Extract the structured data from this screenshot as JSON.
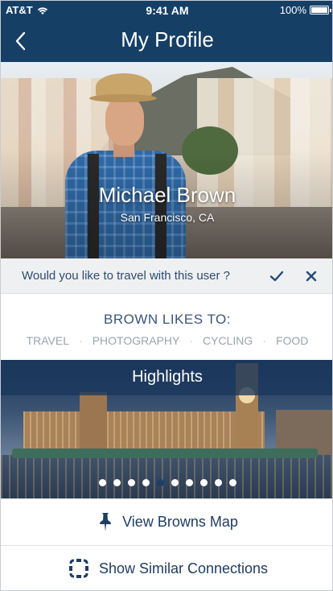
{
  "status_bar": {
    "carrier": "AT&T",
    "time": "9:41 AM",
    "battery": "100%"
  },
  "nav": {
    "title": "My Profile",
    "back_icon": "chevron-left-icon"
  },
  "profile": {
    "name": "Michael Brown",
    "location": "San Francisco, CA"
  },
  "travel_prompt": {
    "question": "Would you like to travel with this user ?",
    "accept_icon": "check-icon",
    "decline_icon": "close-icon"
  },
  "likes": {
    "title": "BROWN LIKES TO:",
    "tags": [
      "TRAVEL",
      "PHOTOGRAPHY",
      "CYCLING",
      "FOOD"
    ],
    "separator": "·"
  },
  "highlights": {
    "title": "Highlights",
    "slide_count": 10,
    "active_slide": 4
  },
  "actions": {
    "map_label": "View Browns Map",
    "map_icon": "pushpin-icon",
    "connections_label": "Show Similar Connections",
    "connections_icon": "connections-icon"
  },
  "colors": {
    "primary": "#163f66",
    "text_dark": "#1f3d62",
    "tag_gray": "#9aa3ad",
    "prompt_bg": "#eef0f2"
  }
}
